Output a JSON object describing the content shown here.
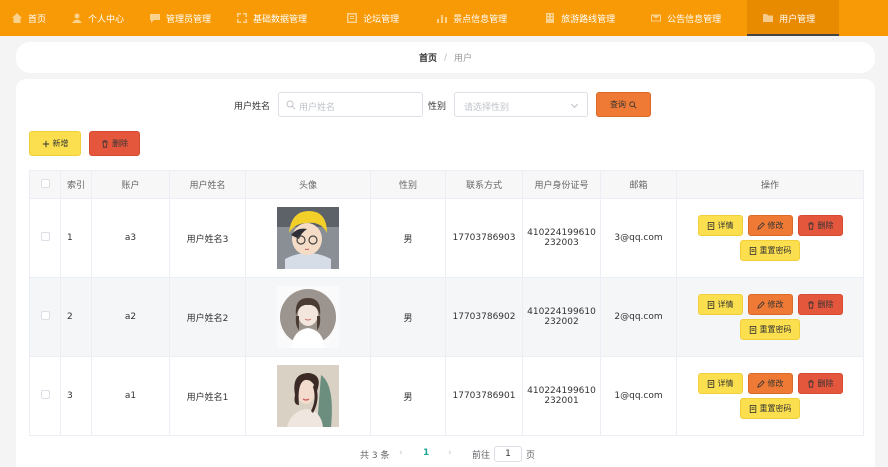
{
  "nav": {
    "items": [
      {
        "label": "首页",
        "icon": "home-icon"
      },
      {
        "label": "个人中心",
        "icon": "user-icon"
      },
      {
        "label": "管理员管理",
        "icon": "chat-icon"
      },
      {
        "label": "基础数据管理",
        "icon": "expand-icon"
      },
      {
        "label": "论坛管理",
        "icon": "forum-icon"
      },
      {
        "label": "景点信息管理",
        "icon": "bar-chart-icon"
      },
      {
        "label": "旅游路线管理",
        "icon": "building-icon"
      },
      {
        "label": "公告信息管理",
        "icon": "mail-icon"
      },
      {
        "label": "用户管理",
        "icon": "folder-icon"
      }
    ],
    "active_index": 8
  },
  "breadcrumb": {
    "home": "首页",
    "separator": "/",
    "current": "用户"
  },
  "search": {
    "name_label": "用户姓名",
    "name_placeholder": "用户姓名",
    "gender_label": "性别",
    "gender_placeholder": "请选择性别",
    "query_label": "查询"
  },
  "toolbar": {
    "add_label": "新增",
    "delete_label": "删除"
  },
  "table": {
    "headers": [
      "索引",
      "账户",
      "用户姓名",
      "头像",
      "性别",
      "联系方式",
      "用户身份证号",
      "邮箱",
      "操作"
    ],
    "rows": [
      {
        "index": "1",
        "account": "a3",
        "name": "用户姓名3",
        "gender": "男",
        "phone": "17703786903",
        "id_line1": "410224199610",
        "id_line2": "232003",
        "email": "3@qq.com",
        "avatar": "avatar-boy-yellow-hat"
      },
      {
        "index": "2",
        "account": "a2",
        "name": "用户姓名2",
        "gender": "男",
        "phone": "17703786902",
        "id_line1": "410224199610",
        "id_line2": "232002",
        "email": "2@qq.com",
        "avatar": "avatar-girl-sketch"
      },
      {
        "index": "3",
        "account": "a1",
        "name": "用户姓名1",
        "gender": "男",
        "phone": "17703786901",
        "id_line1": "410224199610",
        "id_line2": "232001",
        "email": "1@qq.com",
        "avatar": "avatar-girl-painting"
      }
    ],
    "actions": {
      "detail": "详情",
      "edit": "修改",
      "delete": "删除",
      "reset": "重置密码"
    }
  },
  "pagination": {
    "total": "共 3 条",
    "prev": "‹",
    "page": "1",
    "next": "›",
    "goto": "前往",
    "goto_value": "1",
    "page_unit": "页"
  },
  "colors": {
    "nav": "#f79a06",
    "query": "#ee7a36",
    "add": "#fbdf4e",
    "delete": "#e5573d",
    "page_active": "#1fa89a"
  }
}
